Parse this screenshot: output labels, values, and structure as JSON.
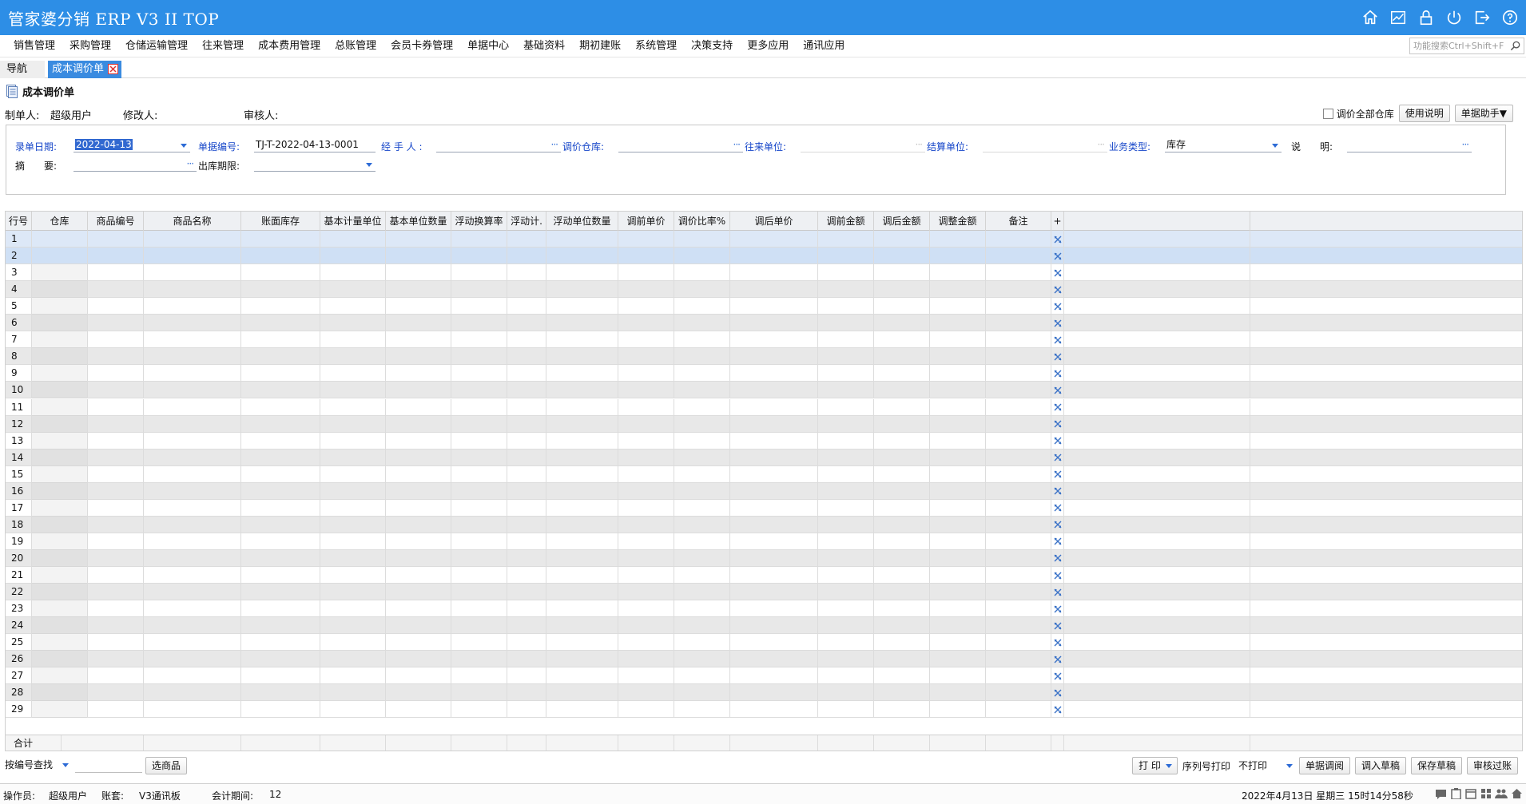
{
  "app": {
    "title": "管家婆分销 ERP V3 II TOP"
  },
  "header_icons": [
    "home-icon",
    "chart-icon",
    "lock-icon",
    "power-icon",
    "exit-icon",
    "help-icon"
  ],
  "menu": {
    "items": [
      "销售管理",
      "采购管理",
      "仓储运输管理",
      "往来管理",
      "成本费用管理",
      "总账管理",
      "会员卡券管理",
      "单据中心",
      "基础资料",
      "期初建账",
      "系统管理",
      "决策支持",
      "更多应用",
      "通讯应用"
    ],
    "search_placeholder": "功能搜索Ctrl+Shift+F"
  },
  "tabs": {
    "nav": "导航",
    "active": "成本调价单"
  },
  "form": {
    "title": "成本调价单",
    "maker_label": "制单人:",
    "maker_value": "超级用户",
    "modifier_label": "修改人:",
    "modifier_value": "",
    "auditor_label": "审核人:",
    "auditor_value": "",
    "all_warehouses_label": "调价全部仓库",
    "help_button": "使用说明",
    "assistant_button": "单据助手▼",
    "fields": {
      "date_label": "录单日期:",
      "date_value": "2022-04-13",
      "number_label": "单据编号:",
      "number_value": "TJ-T-2022-04-13-0001",
      "handler_label": "经 手 人 :",
      "handler_value": "",
      "warehouse_label": "调价仓库:",
      "warehouse_value": "",
      "partner_label": "往来单位:",
      "partner_value": "",
      "settle_label": "结算单位:",
      "settle_value": "",
      "biztype_label": "业务类型:",
      "biztype_value": "库存",
      "note_label": "说　　明:",
      "note_value": "",
      "summary_label": "摘　　要:",
      "summary_value": "",
      "period_label": "出库期限:",
      "period_value": ""
    }
  },
  "grid": {
    "columns": [
      "行号",
      "仓库",
      "商品编号",
      "商品名称",
      "账面库存",
      "基本计量单位",
      "基本单位数量",
      "浮动换算率",
      "浮动计.",
      "浮动单位数量",
      "调前单价",
      "调价比率%",
      "调后单价",
      "调前金额",
      "调后金额",
      "调整金额",
      "备注",
      "+"
    ],
    "row_count": 29,
    "total_label": "合计"
  },
  "bottom": {
    "find_mode": "按编号查找",
    "pick_button": "选商品",
    "print_button": "打 印",
    "serial_label": "序列号打印",
    "serial_value": "不打印",
    "history_button": "单据调阅",
    "load_draft_button": "调入草稿",
    "save_draft_button": "保存草稿",
    "post_button": "审核过账"
  },
  "status": {
    "operator_label": "操作员:",
    "operator_value": "超级用户",
    "account_label": "账套:",
    "account_value": "V3通讯板",
    "period_label": "会计期间:",
    "period_value": "12",
    "datetime": "2022年4月13日  星期三  15时14分58秒"
  }
}
